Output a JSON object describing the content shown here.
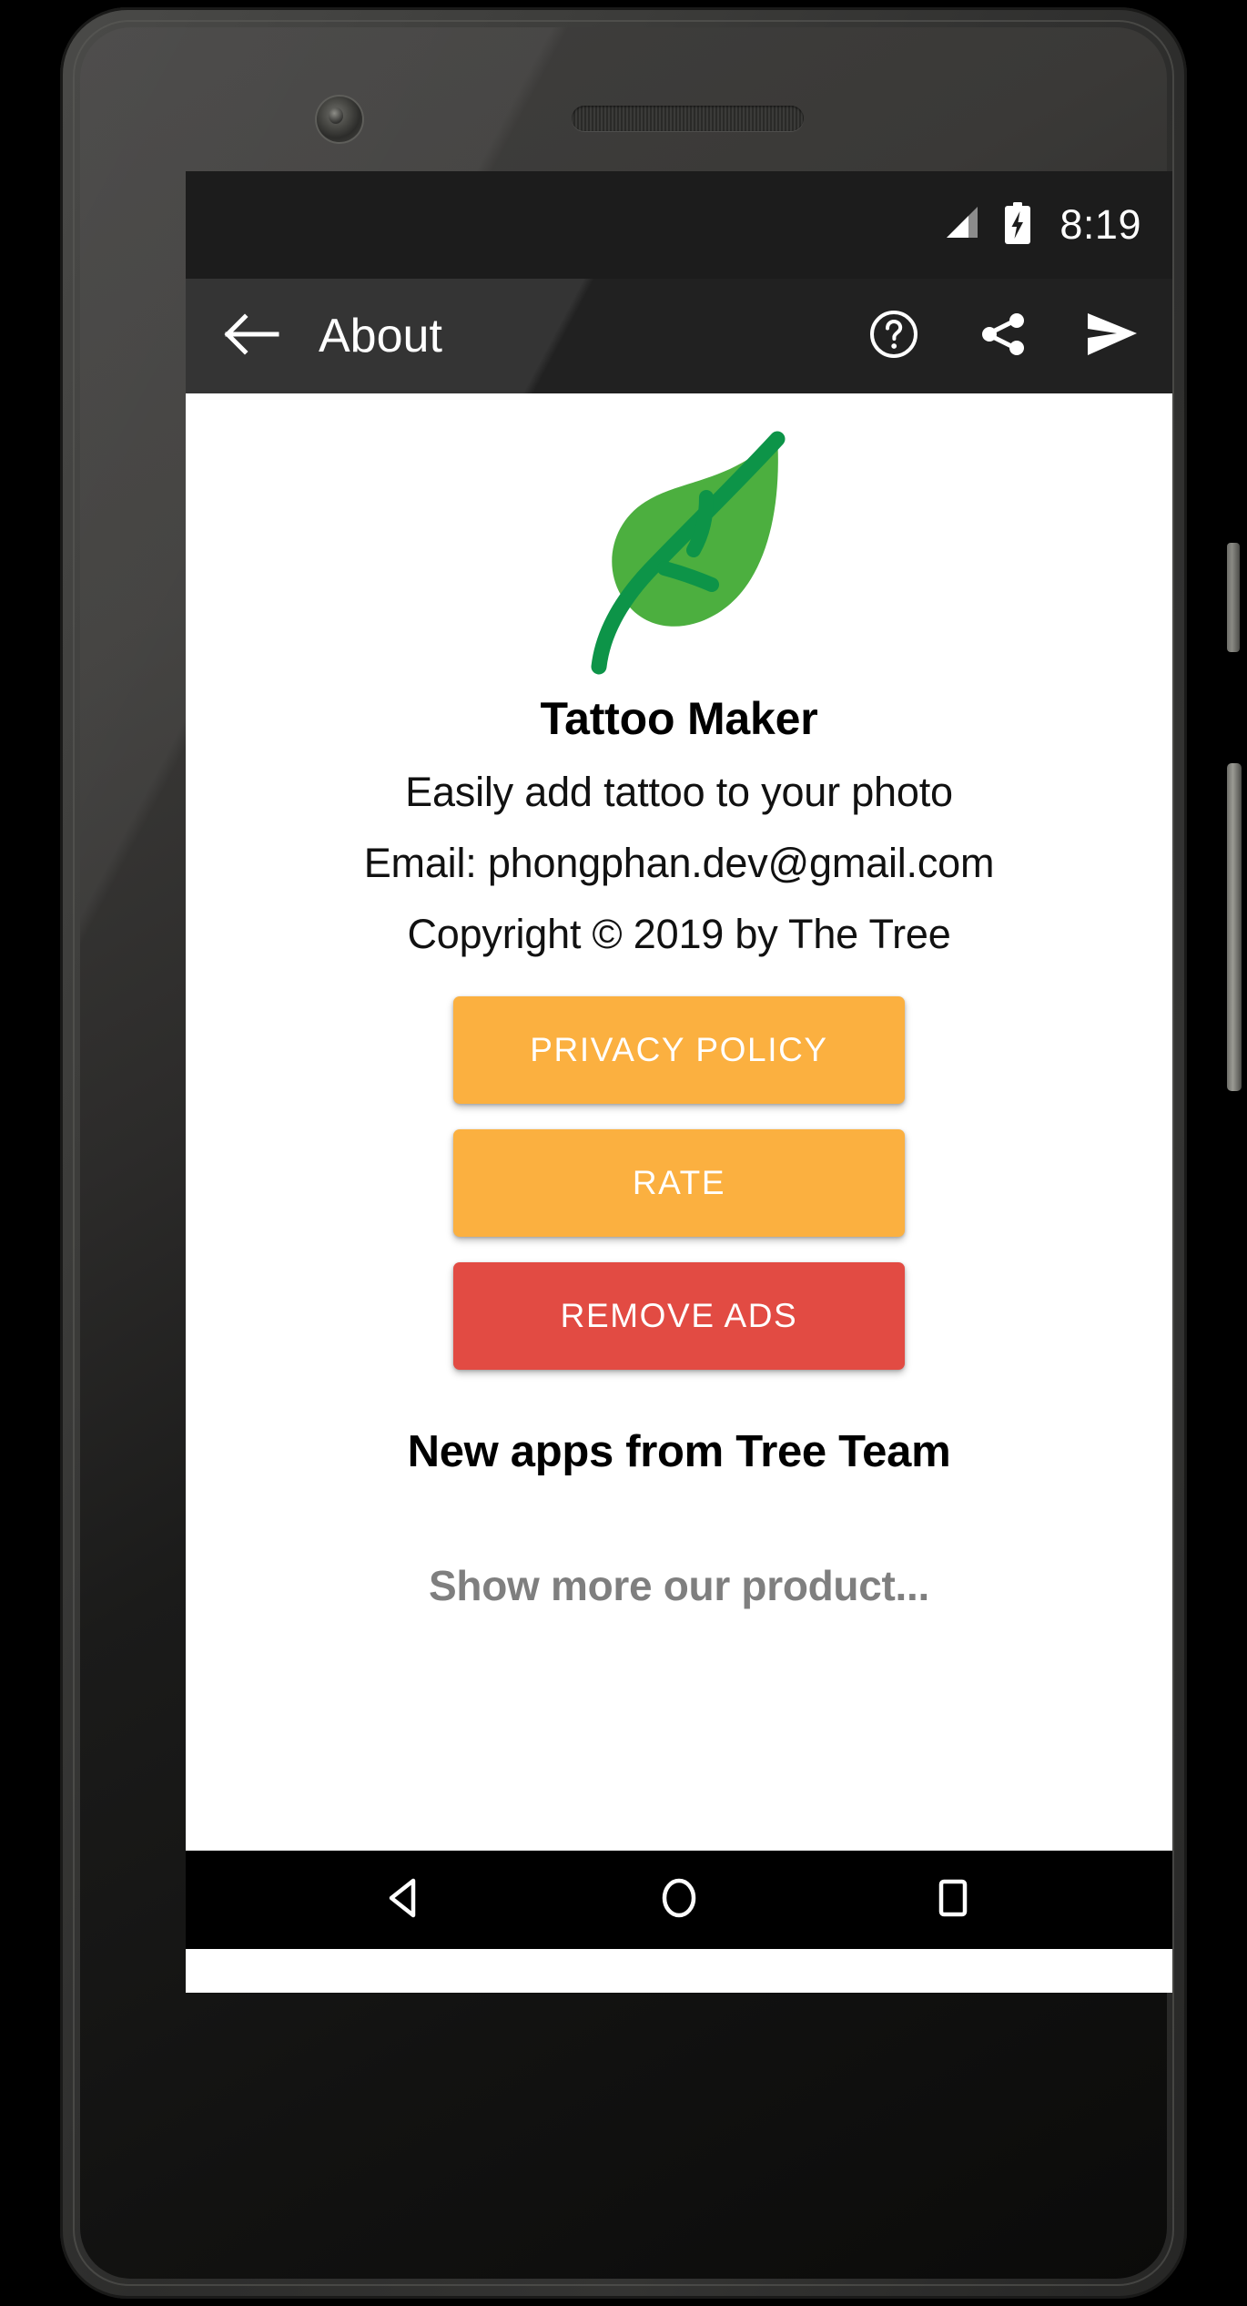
{
  "statusbar": {
    "time": "8:19",
    "signal_icon": "signal-cellular-icon",
    "battery_icon": "battery-charging-icon"
  },
  "appbar": {
    "title": "About",
    "back_icon": "back-arrow-icon",
    "actions": [
      {
        "name": "help-icon",
        "label": "Help"
      },
      {
        "name": "share-icon",
        "label": "Share"
      },
      {
        "name": "send-icon",
        "label": "Send"
      }
    ]
  },
  "content": {
    "logo_icon": "leaf-logo-icon",
    "app_name": "Tattoo Maker",
    "tagline": "Easily add tattoo to your photo",
    "email": "Email: phongphan.dev@gmail.com",
    "copyright": "Copyright © 2019 by The Tree",
    "buttons": [
      {
        "label": "PRIVACY POLICY",
        "color": "#fbb040",
        "name": "privacy-policy-button"
      },
      {
        "label": "RATE",
        "color": "#fbb040",
        "name": "rate-button"
      },
      {
        "label": "REMOVE ADS",
        "color": "#e24b43",
        "name": "remove-ads-button"
      }
    ],
    "section_title": "New apps from Tree Team",
    "show_more": "Show more our product..."
  },
  "navbar": {
    "back_icon": "nav-back-triangle-icon",
    "home_icon": "nav-home-circle-icon",
    "recents_icon": "nav-recents-square-icon"
  },
  "colors": {
    "accent_orange": "#fbb040",
    "accent_red": "#e24b43",
    "leaf_light": "#4caf3f",
    "leaf_dark": "#0d9448",
    "appbar_bg": "#212121",
    "statusbar_bg": "#1c1c1c",
    "muted_text": "#7f7f7f"
  }
}
